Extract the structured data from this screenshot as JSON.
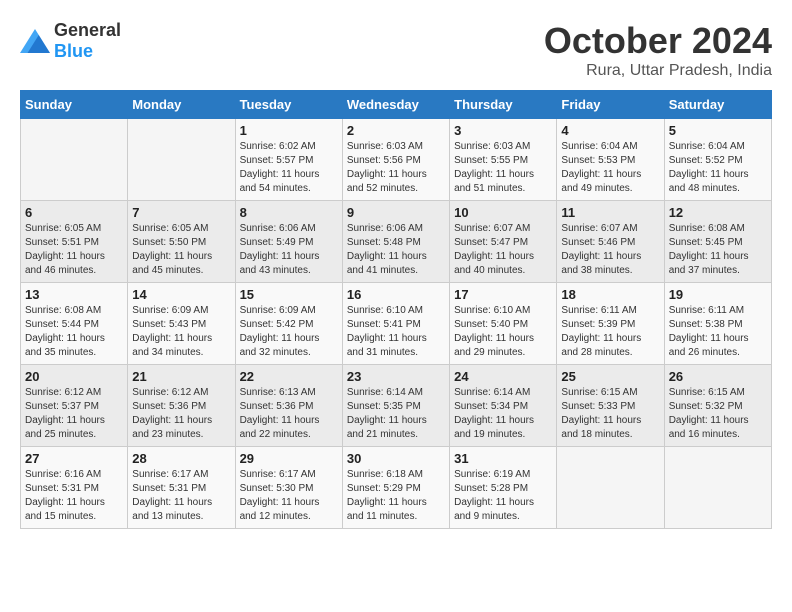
{
  "header": {
    "logo_general": "General",
    "logo_blue": "Blue",
    "month_title": "October 2024",
    "location": "Rura, Uttar Pradesh, India"
  },
  "days_of_week": [
    "Sunday",
    "Monday",
    "Tuesday",
    "Wednesday",
    "Thursday",
    "Friday",
    "Saturday"
  ],
  "weeks": [
    [
      {
        "day": "",
        "info": ""
      },
      {
        "day": "",
        "info": ""
      },
      {
        "day": "1",
        "info": "Sunrise: 6:02 AM\nSunset: 5:57 PM\nDaylight: 11 hours and 54 minutes."
      },
      {
        "day": "2",
        "info": "Sunrise: 6:03 AM\nSunset: 5:56 PM\nDaylight: 11 hours and 52 minutes."
      },
      {
        "day": "3",
        "info": "Sunrise: 6:03 AM\nSunset: 5:55 PM\nDaylight: 11 hours and 51 minutes."
      },
      {
        "day": "4",
        "info": "Sunrise: 6:04 AM\nSunset: 5:53 PM\nDaylight: 11 hours and 49 minutes."
      },
      {
        "day": "5",
        "info": "Sunrise: 6:04 AM\nSunset: 5:52 PM\nDaylight: 11 hours and 48 minutes."
      }
    ],
    [
      {
        "day": "6",
        "info": "Sunrise: 6:05 AM\nSunset: 5:51 PM\nDaylight: 11 hours and 46 minutes."
      },
      {
        "day": "7",
        "info": "Sunrise: 6:05 AM\nSunset: 5:50 PM\nDaylight: 11 hours and 45 minutes."
      },
      {
        "day": "8",
        "info": "Sunrise: 6:06 AM\nSunset: 5:49 PM\nDaylight: 11 hours and 43 minutes."
      },
      {
        "day": "9",
        "info": "Sunrise: 6:06 AM\nSunset: 5:48 PM\nDaylight: 11 hours and 41 minutes."
      },
      {
        "day": "10",
        "info": "Sunrise: 6:07 AM\nSunset: 5:47 PM\nDaylight: 11 hours and 40 minutes."
      },
      {
        "day": "11",
        "info": "Sunrise: 6:07 AM\nSunset: 5:46 PM\nDaylight: 11 hours and 38 minutes."
      },
      {
        "day": "12",
        "info": "Sunrise: 6:08 AM\nSunset: 5:45 PM\nDaylight: 11 hours and 37 minutes."
      }
    ],
    [
      {
        "day": "13",
        "info": "Sunrise: 6:08 AM\nSunset: 5:44 PM\nDaylight: 11 hours and 35 minutes."
      },
      {
        "day": "14",
        "info": "Sunrise: 6:09 AM\nSunset: 5:43 PM\nDaylight: 11 hours and 34 minutes."
      },
      {
        "day": "15",
        "info": "Sunrise: 6:09 AM\nSunset: 5:42 PM\nDaylight: 11 hours and 32 minutes."
      },
      {
        "day": "16",
        "info": "Sunrise: 6:10 AM\nSunset: 5:41 PM\nDaylight: 11 hours and 31 minutes."
      },
      {
        "day": "17",
        "info": "Sunrise: 6:10 AM\nSunset: 5:40 PM\nDaylight: 11 hours and 29 minutes."
      },
      {
        "day": "18",
        "info": "Sunrise: 6:11 AM\nSunset: 5:39 PM\nDaylight: 11 hours and 28 minutes."
      },
      {
        "day": "19",
        "info": "Sunrise: 6:11 AM\nSunset: 5:38 PM\nDaylight: 11 hours and 26 minutes."
      }
    ],
    [
      {
        "day": "20",
        "info": "Sunrise: 6:12 AM\nSunset: 5:37 PM\nDaylight: 11 hours and 25 minutes."
      },
      {
        "day": "21",
        "info": "Sunrise: 6:12 AM\nSunset: 5:36 PM\nDaylight: 11 hours and 23 minutes."
      },
      {
        "day": "22",
        "info": "Sunrise: 6:13 AM\nSunset: 5:36 PM\nDaylight: 11 hours and 22 minutes."
      },
      {
        "day": "23",
        "info": "Sunrise: 6:14 AM\nSunset: 5:35 PM\nDaylight: 11 hours and 21 minutes."
      },
      {
        "day": "24",
        "info": "Sunrise: 6:14 AM\nSunset: 5:34 PM\nDaylight: 11 hours and 19 minutes."
      },
      {
        "day": "25",
        "info": "Sunrise: 6:15 AM\nSunset: 5:33 PM\nDaylight: 11 hours and 18 minutes."
      },
      {
        "day": "26",
        "info": "Sunrise: 6:15 AM\nSunset: 5:32 PM\nDaylight: 11 hours and 16 minutes."
      }
    ],
    [
      {
        "day": "27",
        "info": "Sunrise: 6:16 AM\nSunset: 5:31 PM\nDaylight: 11 hours and 15 minutes."
      },
      {
        "day": "28",
        "info": "Sunrise: 6:17 AM\nSunset: 5:31 PM\nDaylight: 11 hours and 13 minutes."
      },
      {
        "day": "29",
        "info": "Sunrise: 6:17 AM\nSunset: 5:30 PM\nDaylight: 11 hours and 12 minutes."
      },
      {
        "day": "30",
        "info": "Sunrise: 6:18 AM\nSunset: 5:29 PM\nDaylight: 11 hours and 11 minutes."
      },
      {
        "day": "31",
        "info": "Sunrise: 6:19 AM\nSunset: 5:28 PM\nDaylight: 11 hours and 9 minutes."
      },
      {
        "day": "",
        "info": ""
      },
      {
        "day": "",
        "info": ""
      }
    ]
  ]
}
